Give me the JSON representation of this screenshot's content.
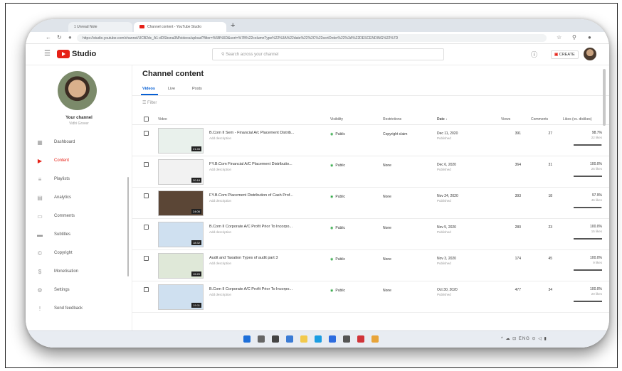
{
  "browser": {
    "tabs": [
      {
        "label": "1 Unread Note"
      },
      {
        "label": "Channel content - YouTube Studio"
      }
    ],
    "new_tab": "+",
    "url": "https://studio.youtube.com/channel/UCB2dc_A1-dDSbsna3M/videos/upload?filter=%5B%5D&sort=%7B%22columnType%22%3A%22date%22%2C%22sortOrder%22%3A%22DESCENDING%22%7D"
  },
  "header": {
    "logo_text": "Studio",
    "search_placeholder": "Search across your channel",
    "create_label": "CREATE"
  },
  "sidebar": {
    "channel_name": "Your channel",
    "channel_sub": "Vidhi Grover",
    "items": [
      {
        "label": "Dashboard",
        "icon": "dashboard-icon",
        "glyph": "▦",
        "active": false
      },
      {
        "label": "Content",
        "icon": "content-icon",
        "glyph": "▶",
        "active": true
      },
      {
        "label": "Playlists",
        "icon": "playlists-icon",
        "glyph": "≡",
        "active": false
      },
      {
        "label": "Analytics",
        "icon": "analytics-icon",
        "glyph": "▤",
        "active": false
      },
      {
        "label": "Comments",
        "icon": "comments-icon",
        "glyph": "▭",
        "active": false
      },
      {
        "label": "Subtitles",
        "icon": "subtitles-icon",
        "glyph": "▬",
        "active": false
      },
      {
        "label": "Copyright",
        "icon": "copyright-icon",
        "glyph": "©",
        "active": false
      },
      {
        "label": "Monetisation",
        "icon": "monetisation-icon",
        "glyph": "$",
        "active": false
      },
      {
        "label": "Settings",
        "icon": "settings-icon",
        "glyph": "⚙",
        "active": false
      },
      {
        "label": "Send feedback",
        "icon": "feedback-icon",
        "glyph": "!",
        "active": false
      }
    ]
  },
  "main": {
    "title": "Channel content",
    "tabs": [
      {
        "label": "Videos"
      },
      {
        "label": "Live"
      },
      {
        "label": "Posts"
      }
    ],
    "filter_label": "Filter",
    "columns": {
      "video": "Video",
      "visibility": "Visibility",
      "restrictions": "Restrictions",
      "date": "Date ↓",
      "views": "Views",
      "comments": "Comments",
      "likes": "Likes (vs. dislikes)"
    },
    "rows": [
      {
        "title": "B.Com II Sem - Financial A/c Placement Distrib...",
        "desc": "Add description",
        "visibility": "Public",
        "restrictions": "Copyright claim",
        "date": "Dec 11, 2020",
        "status": "Published",
        "views": "391",
        "comments": "27",
        "likes_pct": "98.7%",
        "likes_count": "22 likes",
        "likes_frac": 0.987,
        "duration": "21:45",
        "thumb": "#e9f1ec"
      },
      {
        "title": "FY.B.Com Financial A/C Placement Distributio...",
        "desc": "Add description",
        "visibility": "Public",
        "restrictions": "None",
        "date": "Dec 6, 2020",
        "status": "Published",
        "views": "364",
        "comments": "31",
        "likes_pct": "100.0%",
        "likes_count": "25 likes",
        "likes_frac": 1.0,
        "duration": "20:18",
        "thumb": "#f2f2f2"
      },
      {
        "title": "FY.B.Com Placement Distribution of Cash Prof...",
        "desc": "Add description",
        "visibility": "Public",
        "restrictions": "None",
        "date": "Nov 24, 2020",
        "status": "Published",
        "views": "393",
        "comments": "18",
        "likes_pct": "97.9%",
        "likes_count": "46 likes",
        "likes_frac": 0.979,
        "duration": "24:06",
        "thumb": "#5b4636"
      },
      {
        "title": "B.Com II Corporate A/C Profit Prior To Incorpo...",
        "desc": "Add description",
        "visibility": "Public",
        "restrictions": "None",
        "date": "Nov 5, 2020",
        "status": "Published",
        "views": "280",
        "comments": "23",
        "likes_pct": "100.0%",
        "likes_count": "15 likes",
        "likes_frac": 1.0,
        "duration": "18:32",
        "thumb": "#cfe0f0"
      },
      {
        "title": "Audit and Taxation Types of audit part 3",
        "desc": "Add description",
        "visibility": "Public",
        "restrictions": "None",
        "date": "Nov 3, 2020",
        "status": "Published",
        "views": "174",
        "comments": "45",
        "likes_pct": "100.0%",
        "likes_count": "9 likes",
        "likes_frac": 1.0,
        "duration": "15:20",
        "thumb": "#dfe8d8"
      },
      {
        "title": "B.Com II Corporate A/C Profit Prior To Incorpo...",
        "desc": "Add description",
        "visibility": "Public",
        "restrictions": "None",
        "date": "Oct 30, 2020",
        "status": "Published",
        "views": "477",
        "comments": "34",
        "likes_pct": "100.0%",
        "likes_count": "20 likes",
        "likes_frac": 1.0,
        "duration": "19:11",
        "thumb": "#cfe0f0"
      }
    ]
  },
  "taskbar": {
    "tray_text": "^ ☁ ⊡ ENG ⊙ ◁ ▮",
    "apps": [
      {
        "icon": "windows-start-icon",
        "color": "#1e6fd9"
      },
      {
        "icon": "search-icon",
        "color": "#666666"
      },
      {
        "icon": "task-view-icon",
        "color": "#444444"
      },
      {
        "icon": "widgets-icon",
        "color": "#3a7bd5"
      },
      {
        "icon": "file-explorer-icon",
        "color": "#f2c94c"
      },
      {
        "icon": "edge-icon",
        "color": "#1b9de2"
      },
      {
        "icon": "store-icon",
        "color": "#2d6cdf"
      },
      {
        "icon": "mail-icon",
        "color": "#555555"
      },
      {
        "icon": "calendar-icon",
        "color": "#d1343a"
      },
      {
        "icon": "chrome-icon",
        "color": "#e8a43a"
      }
    ]
  }
}
